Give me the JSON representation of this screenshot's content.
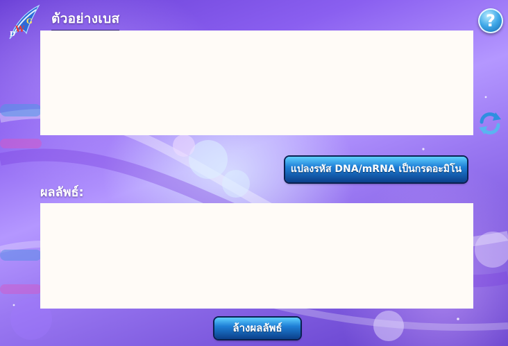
{
  "header": {
    "title": "ตัวอย่างเบส"
  },
  "input_panel": {
    "value": ""
  },
  "result": {
    "label": "ผลลัพธ์:",
    "value": ""
  },
  "buttons": {
    "convert_label": "แปลงรหัส DNA/mRNA เป็นกรดอะมิโน",
    "clear_label": "ล้างผลลัพธ์"
  },
  "icons": {
    "help": "question-mark-icon",
    "refresh": "refresh-icon",
    "logo": "dwg-logo"
  },
  "help_glyph": "?"
}
